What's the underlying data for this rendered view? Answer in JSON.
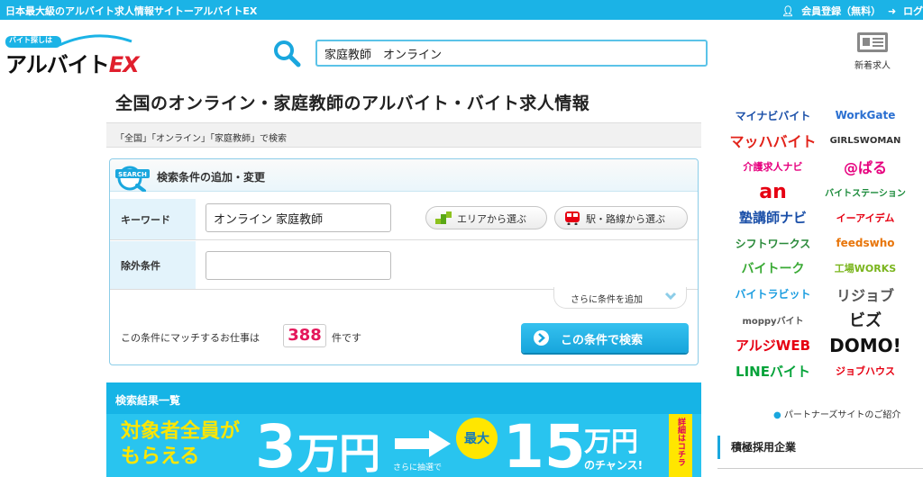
{
  "topbar": {
    "tagline": "日本最大級のアルバイト求人情報サイトーアルバイトEX",
    "register_label": "会員登録（無料）",
    "login_label": "ログ"
  },
  "logo": {
    "small_text": "バイト探しは",
    "word_main": "アルバイト",
    "word_ex": "EX"
  },
  "search": {
    "query": "家庭教師　オンライン"
  },
  "news": {
    "label": "新着求人"
  },
  "page": {
    "title": "全国のオンライン・家庭教師のアルバイト・バイト求人情報",
    "breadcrumb": "「全国」「オンライン」「家庭教師」で検索"
  },
  "panel": {
    "badge": "SEARCH",
    "title": "検索条件の追加・変更",
    "keyword_label": "キーワード",
    "keyword_value": "オンライン 家庭教師",
    "exclude_label": "除外条件",
    "exclude_value": "",
    "area_button": "エリアから選ぶ",
    "station_button": "駅・路線から選ぶ",
    "more_conditions": "さらに条件を追加",
    "match_prefix": "この条件にマッチするお仕事は",
    "match_count": "388",
    "match_suffix": "件です",
    "search_button": "この条件で検索"
  },
  "results": {
    "heading": "検索結果一覧",
    "promo": {
      "line1": "対象者全員が",
      "line2": "もらえる",
      "amount1": "3",
      "unit1": "万円",
      "lottery": "さらに抽選で",
      "max": "最大",
      "amount2": "15",
      "unit2": "万円",
      "chance": "のチャンス!",
      "detail": "詳細はコチラ"
    }
  },
  "partners": {
    "logos": [
      {
        "name": "マイナビバイト",
        "color": "#1a4fa8"
      },
      {
        "name": "WorkGate",
        "color": "#2a6fd1"
      },
      {
        "name": "マッハバイト",
        "color": "#e2231a"
      },
      {
        "name": "GIRLSWOMAN",
        "color": "#333333"
      },
      {
        "name": "介護求人ナビ",
        "color": "#e6007e"
      },
      {
        "name": "@ぱる",
        "color": "#e6007e"
      },
      {
        "name": "an",
        "color": "#e60012"
      },
      {
        "name": "バイトステーション",
        "color": "#1a8a3a"
      },
      {
        "name": "塾講師ナビ",
        "color": "#1a4fa8"
      },
      {
        "name": "イーアイデム",
        "color": "#e60012"
      },
      {
        "name": "シフトワークス",
        "color": "#2a8a3a"
      },
      {
        "name": "feedswho",
        "color": "#e8750a"
      },
      {
        "name": "バイトーク",
        "color": "#3aaa35"
      },
      {
        "name": "工場WORKS",
        "color": "#7ab51d"
      },
      {
        "name": "バイトラビット",
        "color": "#1a9de0"
      },
      {
        "name": "リジョブ",
        "color": "#555555"
      },
      {
        "name": "moppyバイト",
        "color": "#555555"
      },
      {
        "name": "ビズ",
        "color": "#222222"
      },
      {
        "name": "アルジWEB",
        "color": "#e60012"
      },
      {
        "name": "DOMO!",
        "color": "#111111"
      },
      {
        "name": "LINEバイト",
        "color": "#06a33a"
      },
      {
        "name": "ジョブハウス",
        "color": "#e60012"
      }
    ],
    "link": "パートナーズサイトのご紹介"
  },
  "sidebar": {
    "hiring_title": "積極採用企業"
  },
  "colors": {
    "brand": "#1bb3e6",
    "accent": "#e4185b",
    "yellow": "#ffe600"
  }
}
